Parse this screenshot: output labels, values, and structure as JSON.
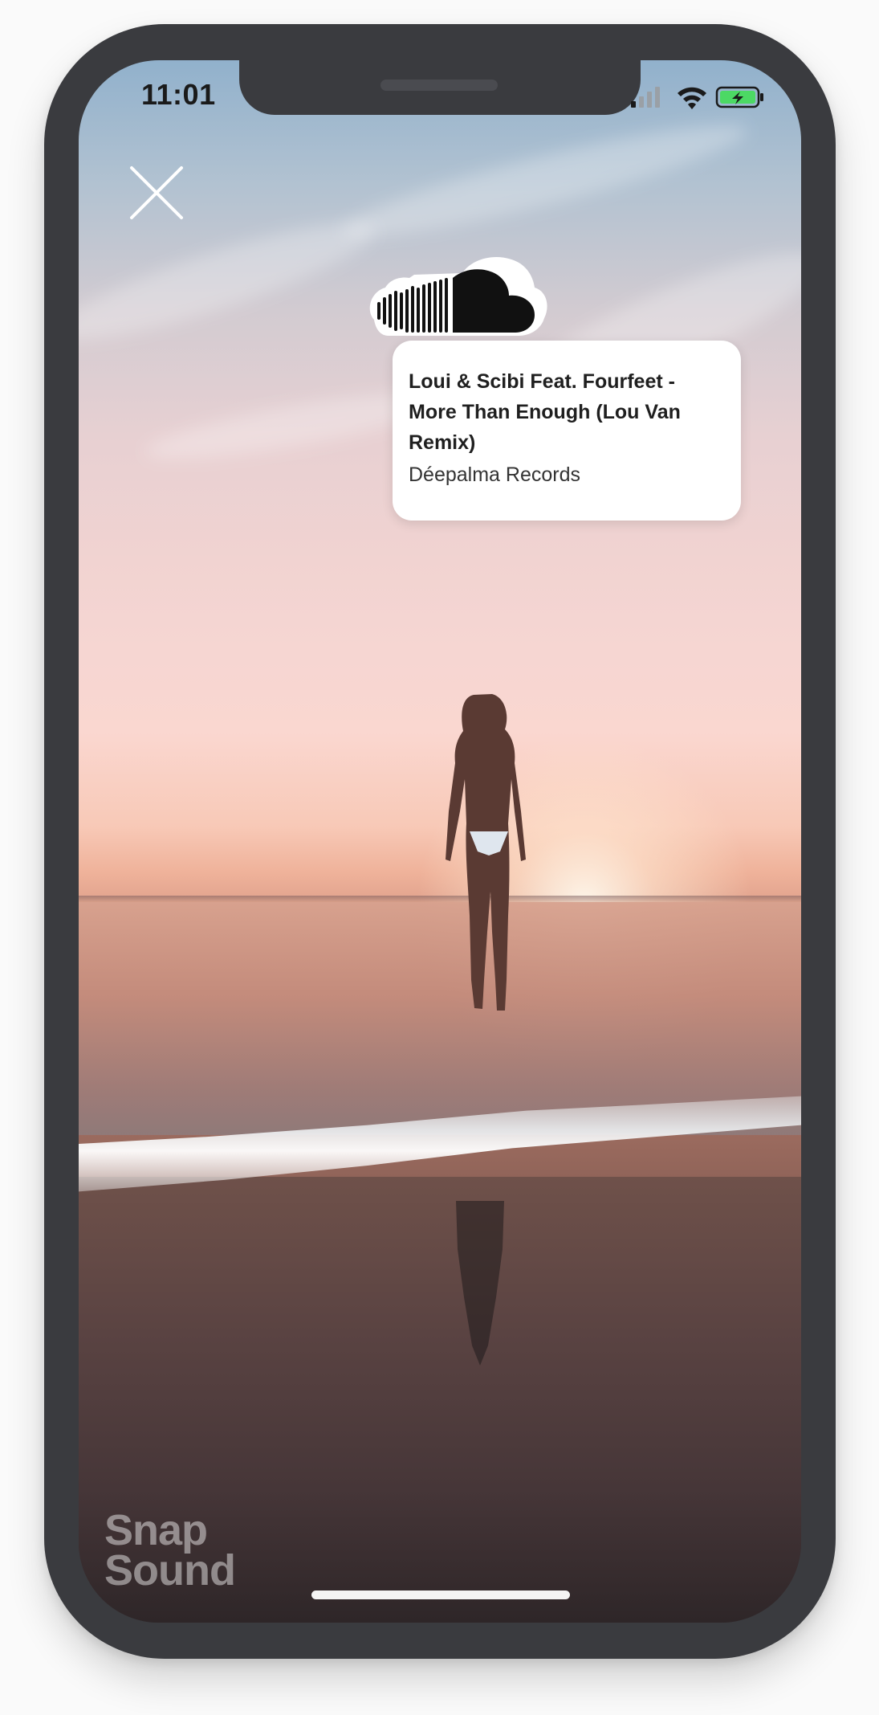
{
  "status_bar": {
    "time": "11:01"
  },
  "close_label": "Close",
  "track": {
    "title": "Loui & Scibi Feat. Fourfeet - More Than Enough (Lou Van Remix)",
    "label": "Déepalma Records",
    "service_icon": "soundcloud-icon"
  },
  "brand": {
    "line1": "Snap",
    "line2": "Sound"
  },
  "colors": {
    "phone_frame": "#3a3b3f",
    "battery_fill": "#4cd964",
    "card_background": "#ffffff"
  }
}
